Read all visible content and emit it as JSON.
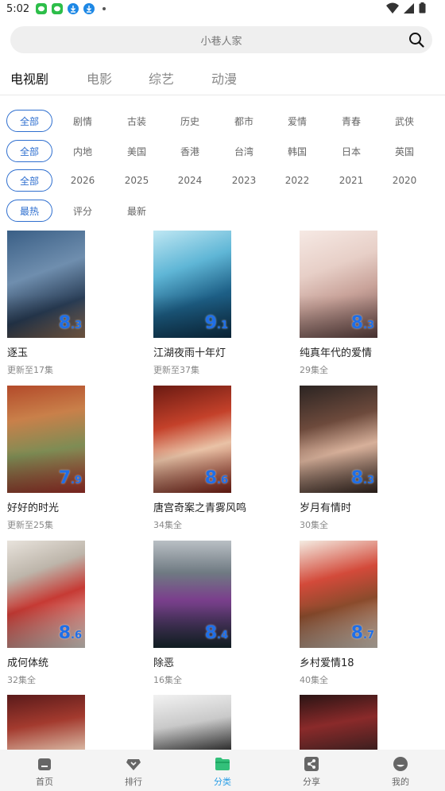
{
  "status": {
    "time": "5:02"
  },
  "search": {
    "placeholder": "小巷人家"
  },
  "top_tabs": [
    "电视剧",
    "电影",
    "综艺",
    "动漫"
  ],
  "filters": {
    "row1": [
      "全部",
      "剧情",
      "古装",
      "历史",
      "都市",
      "爱情",
      "青春",
      "武侠"
    ],
    "row2": [
      "全部",
      "内地",
      "美国",
      "香港",
      "台湾",
      "韩国",
      "日本",
      "英国"
    ],
    "row3": [
      "全部",
      "2026",
      "2025",
      "2024",
      "2023",
      "2022",
      "2021",
      "2020"
    ],
    "row4": [
      "最热",
      "评分",
      "最新"
    ]
  },
  "items": [
    {
      "title": "逐玉",
      "sub": "更新至17集",
      "score_int": "8",
      "score_dec": ".3"
    },
    {
      "title": "江湖夜雨十年灯",
      "sub": "更新至37集",
      "score_int": "9",
      "score_dec": ".1"
    },
    {
      "title": "纯真年代的爱情",
      "sub": "29集全",
      "score_int": "8",
      "score_dec": ".3"
    },
    {
      "title": "好好的时光",
      "sub": "更新至25集",
      "score_int": "7",
      "score_dec": ".9"
    },
    {
      "title": "唐宫奇案之青雾风鸣",
      "sub": "34集全",
      "score_int": "8",
      "score_dec": ".6"
    },
    {
      "title": "岁月有情时",
      "sub": "30集全",
      "score_int": "8",
      "score_dec": ".3"
    },
    {
      "title": "成何体统",
      "sub": "32集全",
      "score_int": "8",
      "score_dec": ".6"
    },
    {
      "title": "除恶",
      "sub": "16集全",
      "score_int": "8",
      "score_dec": ".4"
    },
    {
      "title": "乡村爱情18",
      "sub": "40集全",
      "score_int": "8",
      "score_dec": ".7"
    }
  ],
  "nav": [
    {
      "label": "首页",
      "icon": "home-icon"
    },
    {
      "label": "排行",
      "icon": "diamond-icon"
    },
    {
      "label": "分类",
      "icon": "folder-icon"
    },
    {
      "label": "分享",
      "icon": "share-icon"
    },
    {
      "label": "我的",
      "icon": "profile-icon"
    }
  ],
  "colors": {
    "accent": "#2f6fcf",
    "nav_active": "#2a9ee6",
    "score": "#1f6fe8"
  }
}
